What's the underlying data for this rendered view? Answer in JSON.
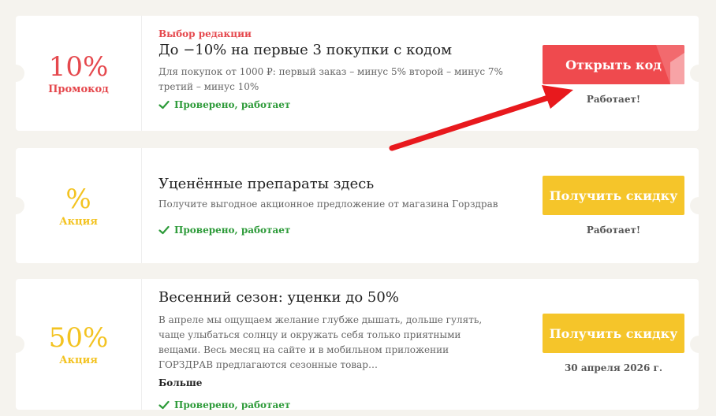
{
  "coupons": [
    {
      "value": "10%",
      "type": "Промокод",
      "editor_label": "Выбор редакции",
      "title": "До −10% на первые 3 покупки с кодом",
      "desc": "Для покупок от 1000 ₽: первый заказ – минус 5% второй – минус 7% третий – минус 10%",
      "verified": "Проверено, работает",
      "button": "Открыть код",
      "status": "Работает!"
    },
    {
      "value": "%",
      "type": "Акция",
      "title": "Уценённые препараты здесь",
      "desc": "Получите выгодное акционное предложение от магазина Горздрав",
      "verified": "Проверено, работает",
      "button": "Получить скидку",
      "status": "Работает!"
    },
    {
      "value": "50%",
      "type": "Акция",
      "title": "Весенний сезон: уценки до 50%",
      "desc": "В апреле мы ощущаем желание глубже дышать, дольше гулять, чаще улыбаться солнцу и окружать себя только приятными вещами. Весь месяц на сайте и в мобильном приложении ГОРЗДРАВ предлагаются сезонные товар…",
      "more": "Больше",
      "verified": "Проверено, работает",
      "button": "Получить скидку",
      "status": "30 апреля 2026 г."
    }
  ],
  "colors": {
    "red": "#e5484d",
    "yellow": "#f3c321",
    "green": "#2e9b3a"
  }
}
